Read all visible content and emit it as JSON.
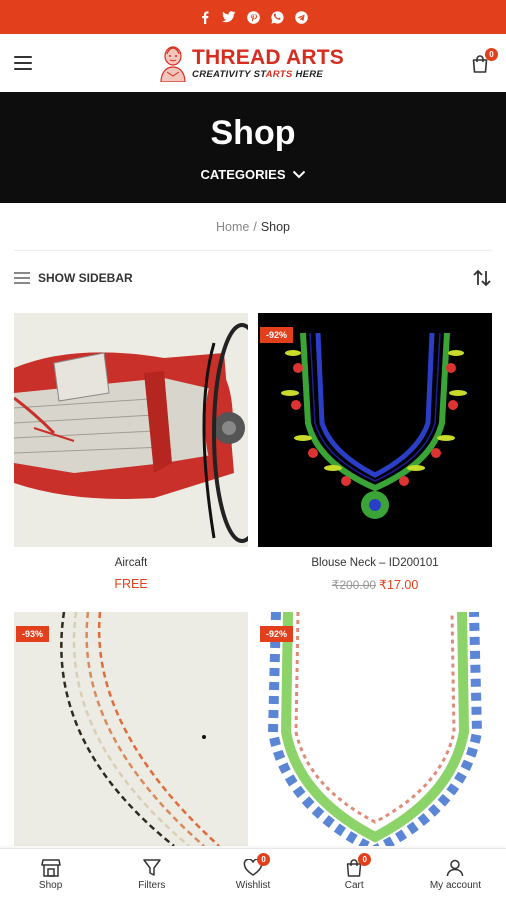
{
  "topbar": {
    "icons": [
      "facebook-icon",
      "twitter-icon",
      "pinterest-icon",
      "whatsapp-icon",
      "telegram-icon"
    ],
    "color": "#e2401c"
  },
  "header": {
    "logo_title": "THREAD ARTS",
    "logo_tag_a": "CREATIVITY ST",
    "logo_tag_b": "ARTS",
    "logo_tag_c": " HERE",
    "cart_count": "0"
  },
  "hero": {
    "title": "Shop",
    "categories_label": "CATEGORIES"
  },
  "breadcrumb": {
    "home": "Home",
    "separator": "/",
    "current": "Shop"
  },
  "toolbar": {
    "sidebar_label": "SHOW SIDEBAR"
  },
  "products": [
    {
      "name": "Aircaft",
      "price": "FREE",
      "sale": ""
    },
    {
      "name": "Blouse Neck – ID200101",
      "old_price": "₹200.00",
      "price": "₹17.00",
      "sale": "-92%"
    },
    {
      "name": "",
      "price": "",
      "sale": "-93%"
    },
    {
      "name": "",
      "price": "",
      "sale": "-92%"
    }
  ],
  "bottom_nav": {
    "shop": "Shop",
    "filters": "Filters",
    "wishlist": "Wishlist",
    "wishlist_count": "0",
    "cart": "Cart",
    "cart_count": "0",
    "account": "My account"
  },
  "colors": {
    "accent": "#e2401c",
    "hero_bg": "#0d0d0d"
  }
}
